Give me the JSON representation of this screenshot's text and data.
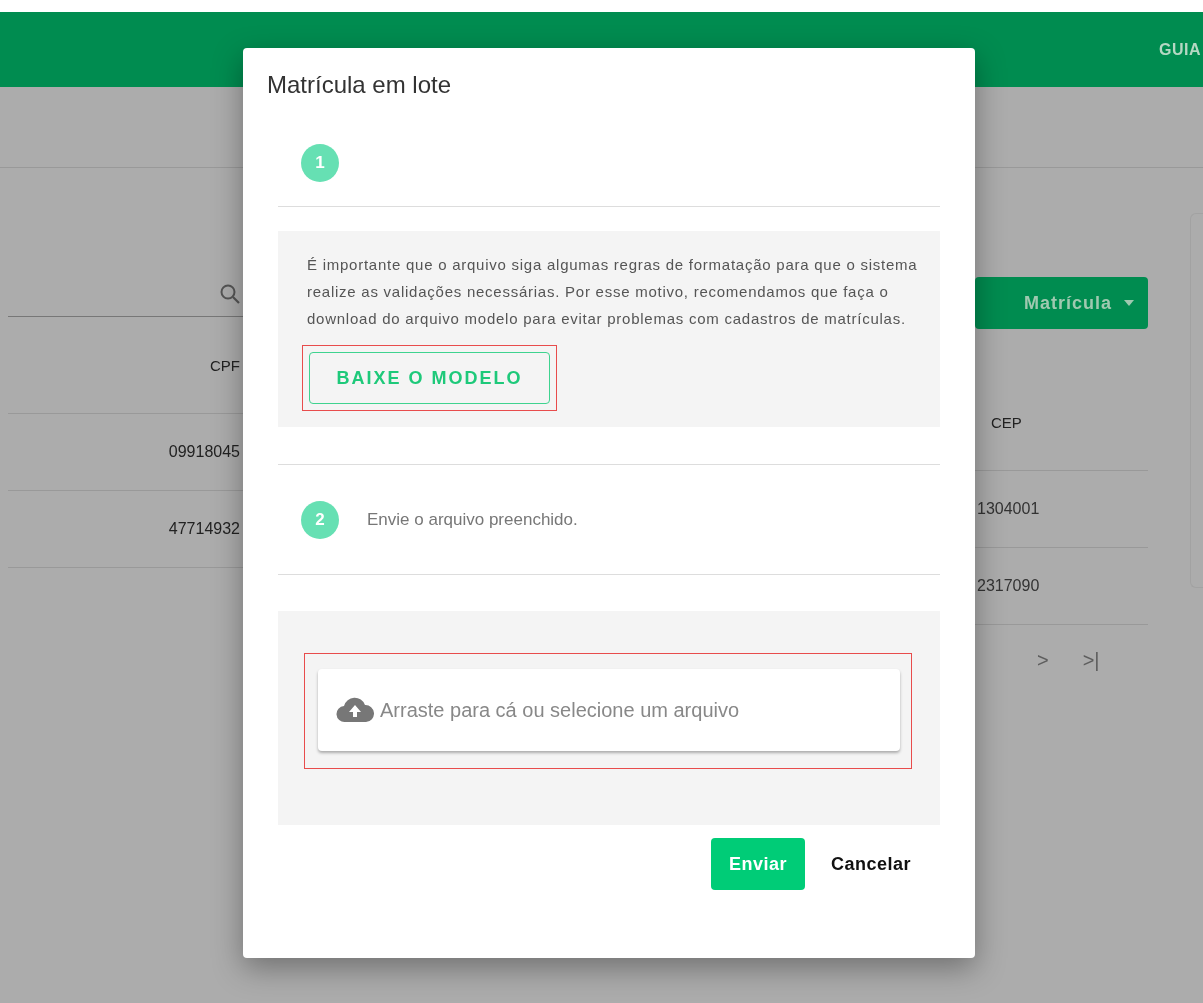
{
  "header": {
    "menu_item": "GUIA"
  },
  "toolbar": {
    "button": "Matrícula"
  },
  "table": {
    "columns": [
      "CPF",
      "CEP"
    ],
    "rows": [
      [
        "09918045",
        "1304001"
      ],
      [
        "47714932",
        "2317090"
      ]
    ]
  },
  "pagination": [
    ">",
    ">|"
  ],
  "dialog": {
    "title": "Matrícula em lote",
    "steps": [
      {
        "number": "1"
      },
      {
        "number": "2",
        "text": "Envie o arquivo preenchido."
      }
    ],
    "info_text": "É importante que o arquivo siga algumas regras de formatação para que o sistema realize as validações necessárias. Por esse motivo, recomendamos que faça o download do arquivo modelo para evitar problemas com cadastros de matrículas.",
    "download_button": {
      "label": "BAIXE O MODELO",
      "highlighted": true
    },
    "dropzone": {
      "text": "Arraste para cá ou selecione um arquivo",
      "highlighted": true
    },
    "actions": [
      {
        "label": "Enviar",
        "kind": "primary"
      },
      {
        "label": "Cancelar",
        "kind": "text"
      }
    ]
  }
}
